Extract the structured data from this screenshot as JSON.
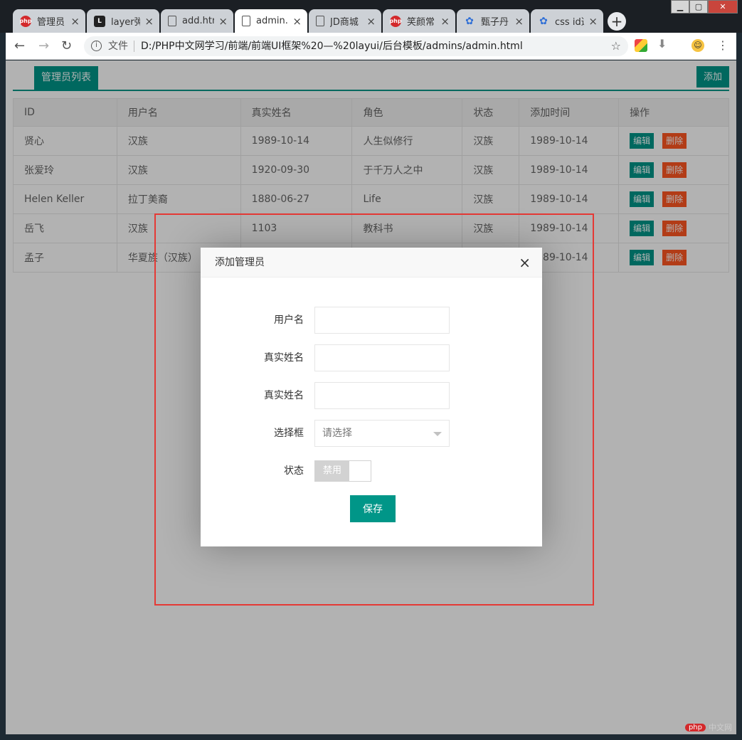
{
  "browser": {
    "tabs": [
      {
        "title": "管理员",
        "icon": "php",
        "active": false
      },
      {
        "title": "layer弹",
        "icon": "layer",
        "active": false
      },
      {
        "title": "add.htr",
        "icon": "doc",
        "active": false
      },
      {
        "title": "admin.",
        "icon": "doc",
        "active": true
      },
      {
        "title": "JD商城",
        "icon": "doc",
        "active": false
      },
      {
        "title": "笑颜常",
        "icon": "php",
        "active": false
      },
      {
        "title": "甄子丹",
        "icon": "paw",
        "active": false
      },
      {
        "title": "css id选",
        "icon": "paw",
        "active": false
      }
    ],
    "new_tab": "+",
    "address": {
      "scheme_label": "文件",
      "url": "D:/PHP中文网学习/前端/前端UI框架%20—%20layui/后台模板/admins/admin.html"
    }
  },
  "page": {
    "tab_label": "管理员列表",
    "add_label": "添加",
    "table": {
      "headers": [
        "ID",
        "用户名",
        "真实姓名",
        "角色",
        "状态",
        "添加时间",
        "操作"
      ],
      "rows": [
        [
          "贤心",
          "汉族",
          "1989-10-14",
          "人生似修行",
          "汉族",
          "1989-10-14"
        ],
        [
          "张爱玲",
          "汉族",
          "1920-09-30",
          "于千万人之中",
          "汉族",
          "1989-10-14"
        ],
        [
          "Helen Keller",
          "拉丁美裔",
          "1880-06-27",
          "Life",
          "汉族",
          "1989-10-14"
        ],
        [
          "岳飞",
          "汉族",
          "1103",
          "教科书",
          "汉族",
          "1989-10-14"
        ],
        [
          "孟子",
          "华夏族（汉族）",
          "",
          "",
          "",
          "1989-10-14"
        ]
      ],
      "edit_label": "编辑",
      "delete_label": "删除"
    }
  },
  "modal": {
    "title": "添加管理员",
    "close_glyph": "×",
    "fields": {
      "username_label": "用户名",
      "realname_label": "真实姓名",
      "realname2_label": "真实姓名",
      "select_label": "选择框",
      "select_placeholder": "请选择",
      "status_label": "状态",
      "status_value": "禁用"
    },
    "save_label": "保存"
  },
  "watermark": {
    "logo": "php",
    "text": "中文网"
  },
  "colors": {
    "primary": "#009688",
    "danger": "#ff5722",
    "annotation": "#e53935"
  }
}
